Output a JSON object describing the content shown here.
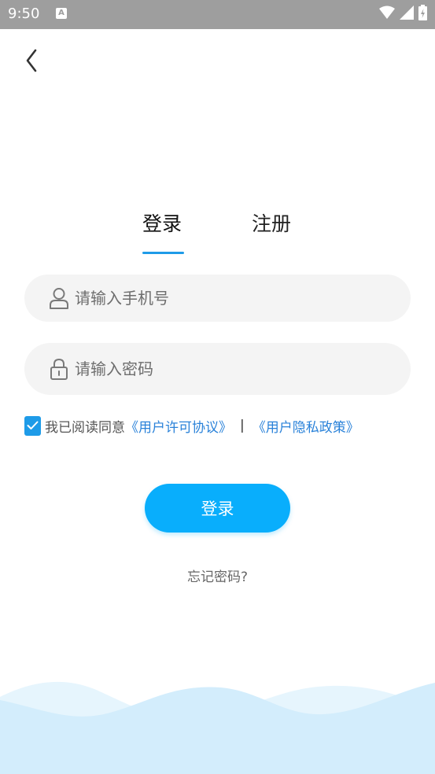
{
  "status_bar": {
    "time": "9:50",
    "notification_icon": "a-icon",
    "icons": [
      "wifi-icon",
      "signal-icon",
      "battery-charging-icon"
    ]
  },
  "back_icon": "chevron-left-icon",
  "tabs": [
    {
      "label": "登录",
      "active": true
    },
    {
      "label": "注册",
      "active": false
    }
  ],
  "form": {
    "phone_placeholder": "请输入手机号",
    "phone_value": "",
    "phone_icon": "user-icon",
    "password_placeholder": "请输入密码",
    "password_value": "",
    "password_icon": "lock-icon"
  },
  "agreement": {
    "checked": true,
    "prefix": "我已阅读同意",
    "user_agreement": "《用户许可协议》",
    "separator": "|",
    "privacy_policy": "《用户隐私政策》"
  },
  "login_button": "登录",
  "forgot_password": "忘记密码?",
  "colors": {
    "accent": "#09aefc",
    "link": "#2a82d9",
    "checkbox": "#1e9be8",
    "status_bar": "#9e9e9e",
    "wave_light": "#e6f5fd",
    "wave_dark": "#d3edfc"
  }
}
